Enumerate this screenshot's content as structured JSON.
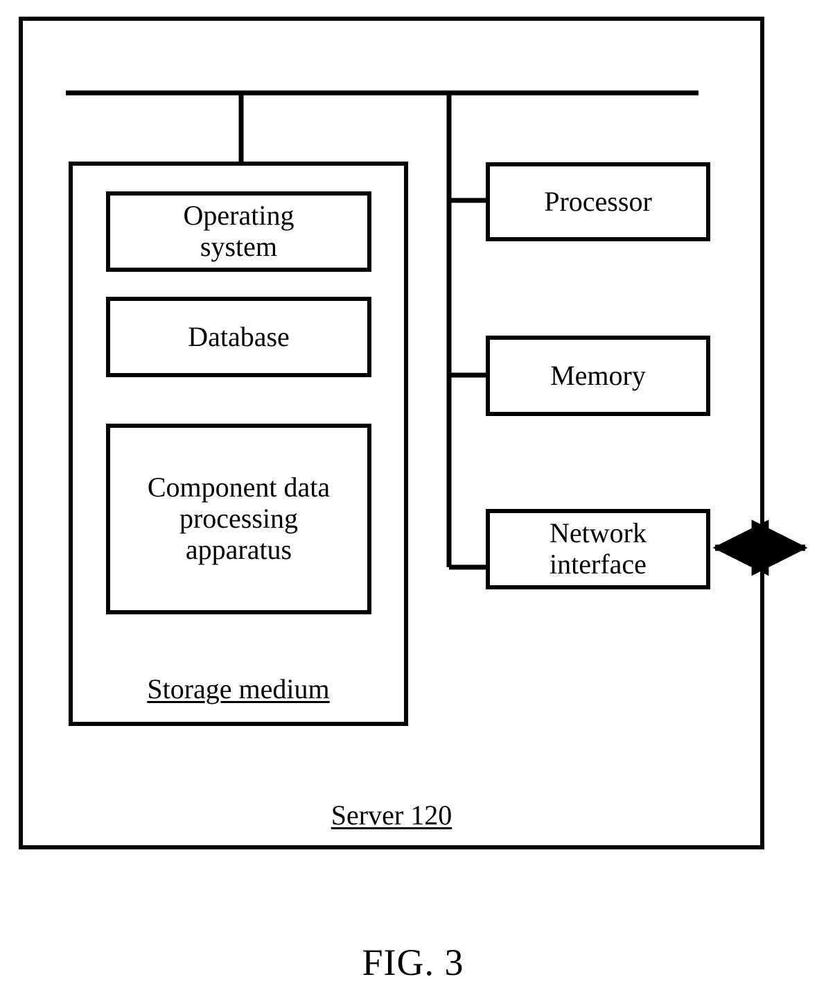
{
  "figure": {
    "caption": "FIG. 3",
    "outer_container_label": "Server 120",
    "stroke_color": "#000000",
    "background_color": "#ffffff"
  },
  "server": {
    "storage_medium": {
      "label": "Storage medium",
      "items": [
        {
          "label": "Operating\nsystem",
          "name": "operating-system"
        },
        {
          "label": "Database",
          "name": "database"
        },
        {
          "label": "Component data\nprocessing\napparatus",
          "name": "component-data-processing-apparatus"
        }
      ]
    },
    "hardware": [
      {
        "label": "Processor",
        "name": "processor"
      },
      {
        "label": "Memory",
        "name": "memory"
      },
      {
        "label": "Network\ninterface",
        "name": "network-interface"
      }
    ],
    "external_link": {
      "name": "bidirectional-network-arrow",
      "description": "double headed arrow"
    }
  }
}
